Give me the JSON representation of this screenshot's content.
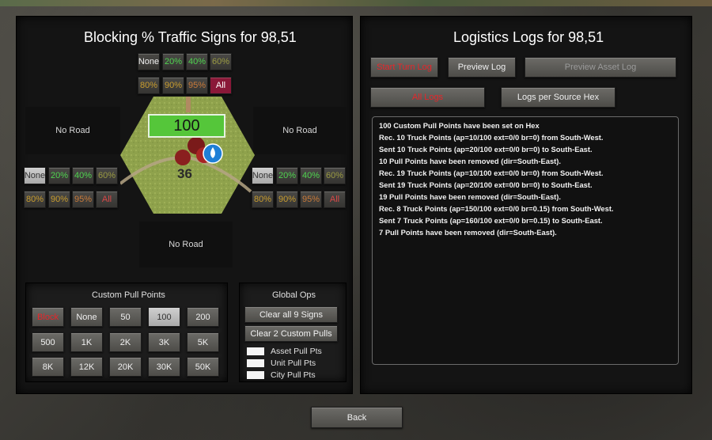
{
  "left": {
    "title": "Blocking % Traffic Signs for 98,51",
    "top_signs": [
      "None",
      "20%",
      "40%",
      "60%",
      "80%",
      "90%",
      "95%",
      "All"
    ],
    "left_signs": [
      "None",
      "20%",
      "40%",
      "60%",
      "80%",
      "90%",
      "95%",
      "All"
    ],
    "right_signs": [
      "None",
      "20%",
      "40%",
      "60%",
      "80%",
      "90%",
      "95%",
      "All"
    ],
    "no_road_left": "No Road",
    "no_road_right": "No Road",
    "no_road_bottom": "No Road",
    "hex": {
      "value": "100",
      "unit_count": "36"
    }
  },
  "custom_pull": {
    "title": "Custom Pull Points",
    "buttons": [
      "Block",
      "None",
      "50",
      "100",
      "200",
      "500",
      "1K",
      "2K",
      "3K",
      "5K",
      "8K",
      "12K",
      "20K",
      "30K",
      "50K"
    ]
  },
  "global_ops": {
    "title": "Global Ops",
    "clear_signs": "Clear all 9 Signs",
    "clear_pulls": "Clear 2 Custom Pulls",
    "legend": [
      "Asset Pull Pts",
      "Unit Pull Pts",
      "City Pull Pts"
    ]
  },
  "right": {
    "title": "Logistics Logs for 98,51",
    "start_turn_log": "Start Turn Log",
    "preview_log": "Preview Log",
    "preview_asset_log": "Preview Asset Log",
    "all_logs": "All Logs",
    "logs_per_source": "Logs per Source Hex",
    "log_lines": [
      "100 Custom Pull Points have been set on Hex",
      "Rec. 10 Truck Points (ap=10/100 ext=0/0 br=0) from South-West.",
      "Sent 10 Truck Points (ap=20/100 ext=0/0 br=0) to South-East.",
      "10 Pull Points have been removed (dir=South-East).",
      "Rec. 19 Truck Points (ap=10/100 ext=0/0 br=0) from South-West.",
      "Sent 19 Truck Points (ap=20/100 ext=0/0 br=0) to South-East.",
      "19 Pull Points have been removed (dir=South-East).",
      "Rec. 8 Truck Points (ap=150/100 ext=0/0 br=0.15) from South-West.",
      "Sent 7 Truck Points (ap=160/100 ext=0/0 br=0.15) to South-East.",
      "7 Pull Points have been removed (dir=South-East)."
    ]
  },
  "back": "Back"
}
